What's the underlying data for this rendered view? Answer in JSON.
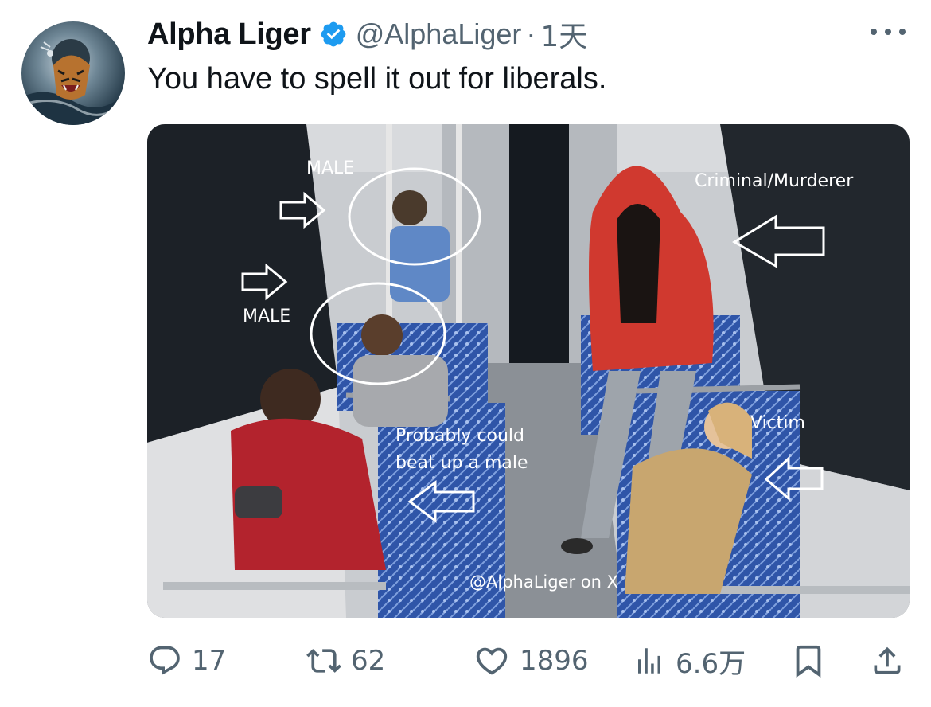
{
  "tweet": {
    "author": {
      "display_name": "Alpha Liger",
      "handle": "@AlphaLiger",
      "verified_icon": "verified-badge-icon"
    },
    "timestamp": "1天",
    "text": "You have to spell it out for liberals.",
    "media": {
      "annotations": {
        "male_top": "MALE",
        "male_left": "MALE",
        "criminal": "Criminal/Murderer",
        "victim": "Victim",
        "probably_line1": "Probably could",
        "probably_line2": "beat up a male",
        "watermark": "@AlphaLiger on X"
      }
    },
    "actions": {
      "reply_count": "17",
      "repost_count": "62",
      "like_count": "1896",
      "views_count": "6.6万"
    }
  },
  "colors": {
    "text_primary": "#0f1419",
    "text_secondary": "#536471",
    "verified_blue": "#1d9bf0"
  }
}
